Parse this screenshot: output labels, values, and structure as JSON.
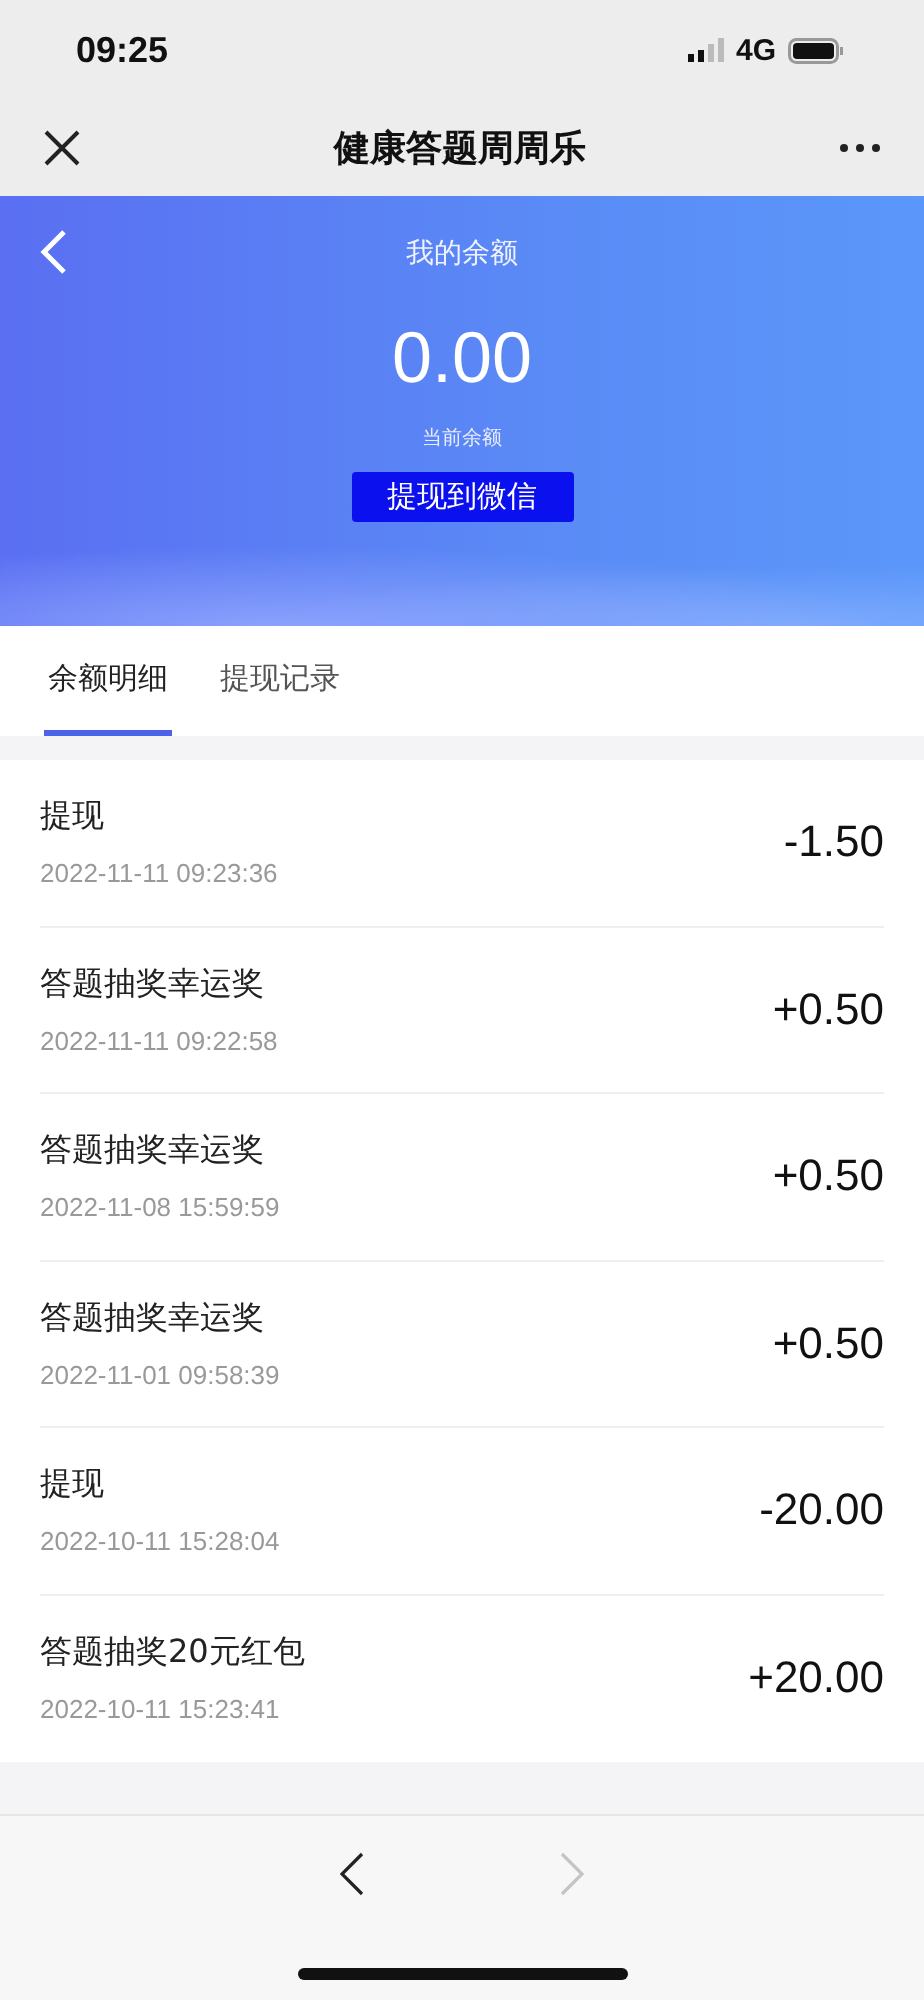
{
  "status_bar": {
    "time": "09:25",
    "network": "4G"
  },
  "nav_bar": {
    "title": "健康答题周周乐"
  },
  "header": {
    "title": "我的余额",
    "balance": "0.00",
    "balance_label": "当前余额",
    "withdraw_button": "提现到微信"
  },
  "tabs": [
    {
      "label": "余额明细",
      "selected": true
    },
    {
      "label": "提现记录",
      "selected": false
    }
  ],
  "records": [
    {
      "title": "提现",
      "time": "2022-11-11 09:23:36",
      "amount": "-1.50"
    },
    {
      "title": "答题抽奖幸运奖",
      "time": "2022-11-11 09:22:58",
      "amount": "+0.50"
    },
    {
      "title": "答题抽奖幸运奖",
      "time": "2022-11-08 15:59:59",
      "amount": "+0.50"
    },
    {
      "title": "答题抽奖幸运奖",
      "time": "2022-11-01 09:58:39",
      "amount": "+0.50"
    },
    {
      "title": "提现",
      "time": "2022-10-11 15:28:04",
      "amount": "-20.00"
    },
    {
      "title": "答题抽奖20元红包",
      "time": "2022-10-11 15:23:41",
      "amount": "+20.00"
    }
  ],
  "toolbar": {
    "forward_disabled": true
  }
}
